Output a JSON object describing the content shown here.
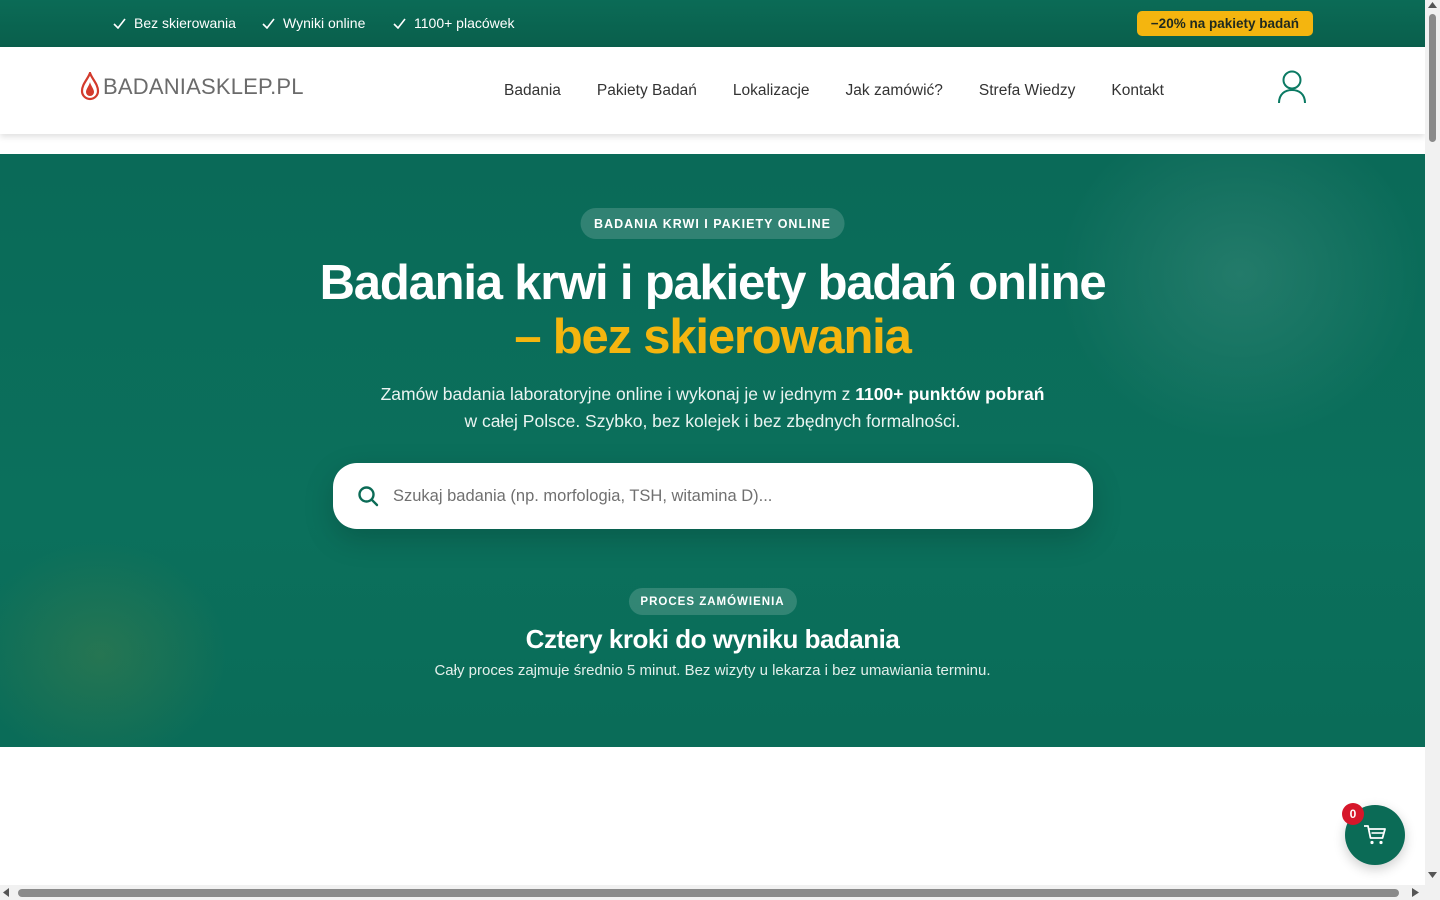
{
  "topbar": {
    "items": [
      "Bez skierowania",
      "Wyniki online",
      "1100+ placówek"
    ],
    "promo": "−20% na pakiety badań",
    "check_icon": "check-icon"
  },
  "header": {
    "logo_text": "BADANIASKLEP.PL",
    "logo_icon": "blood-drop-icon",
    "nav": [
      "Badania",
      "Pakiety Badań",
      "Lokalizacje",
      "Jak zamówić?",
      "Strefa Wiedzy",
      "Kontakt"
    ],
    "user_icon": "user-icon"
  },
  "hero": {
    "badge": "BADANIA KRWI I PAKIETY ONLINE",
    "title_line1": "Badania krwi i pakiety badań online",
    "title_line2": "– bez skierowania",
    "sub_part1": "Zamów badania laboratoryjne online i wykonaj je w jednym z ",
    "sub_strong": "1100+ punktów pobrań",
    "sub_line2": "w całej Polsce. Szybko, bez kolejek i bez zbędnych formalności.",
    "search_placeholder": "Szukaj badania (np. morfologia, TSH, witamina D)...",
    "search_value": ""
  },
  "process": {
    "badge": "PROCES ZAMÓWIENIA",
    "title": "Cztery kroki do wyniku badania",
    "subtitle": "Cały proces zajmuje średnio 5 minut. Bez wizyty u lekarza i bez umawiania terminu."
  },
  "cart": {
    "count": "0",
    "icon": "cart-icon"
  },
  "colors": {
    "brand_green": "#0b6b56",
    "accent_yellow": "#f4b50f",
    "cart_badge_red": "#d6162a",
    "logo_red": "#d33a2c"
  }
}
